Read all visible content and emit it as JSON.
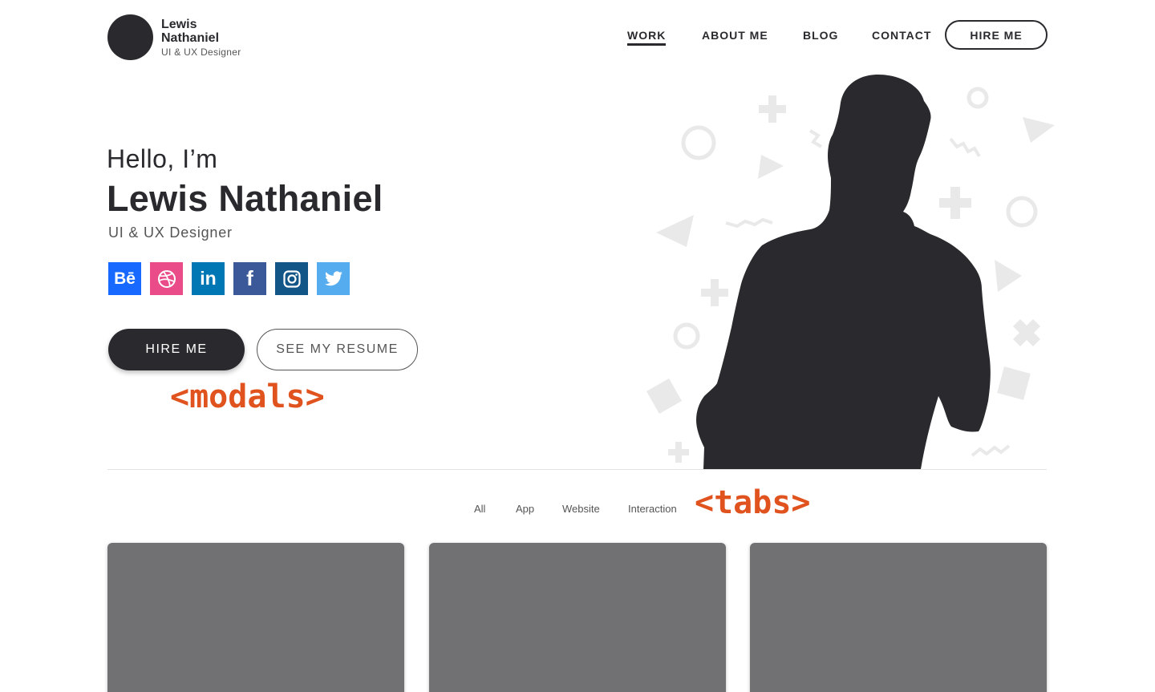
{
  "header": {
    "logo_name": "Lewis Nathaniel",
    "logo_role": "UI & UX Designer",
    "nav": [
      {
        "label": "WORK",
        "active": true
      },
      {
        "label": "ABOUT ME",
        "active": false
      },
      {
        "label": "BLOG",
        "active": false
      },
      {
        "label": "CONTACT",
        "active": false
      }
    ],
    "hire_button": "HIRE ME"
  },
  "hero": {
    "greeting": "Hello, I’m",
    "name": "Lewis Nathaniel",
    "role": "UI & UX Designer",
    "socials": [
      {
        "name": "behance",
        "icon": "behance-icon",
        "color": "#1769ff",
        "glyph": "Bē"
      },
      {
        "name": "dribbble",
        "icon": "dribbble-icon",
        "color": "#ea4c89"
      },
      {
        "name": "linkedin",
        "icon": "linkedin-icon",
        "color": "#0077b5",
        "glyph": "in"
      },
      {
        "name": "facebook",
        "icon": "facebook-icon",
        "color": "#3b5998",
        "glyph": "f"
      },
      {
        "name": "instagram",
        "icon": "instagram-icon",
        "color": "#125688"
      },
      {
        "name": "twitter",
        "icon": "twitter-icon",
        "color": "#55acee"
      }
    ],
    "primary_button": "HIRE ME",
    "secondary_button": "SEE MY RESUME"
  },
  "annotations": {
    "modals": "<modals>",
    "tabs": "<tabs>"
  },
  "tabs": [
    "All",
    "App",
    "Website",
    "Interaction"
  ],
  "colors": {
    "dark": "#2a292d",
    "annotation": "#e0531e",
    "card": "#717073"
  }
}
